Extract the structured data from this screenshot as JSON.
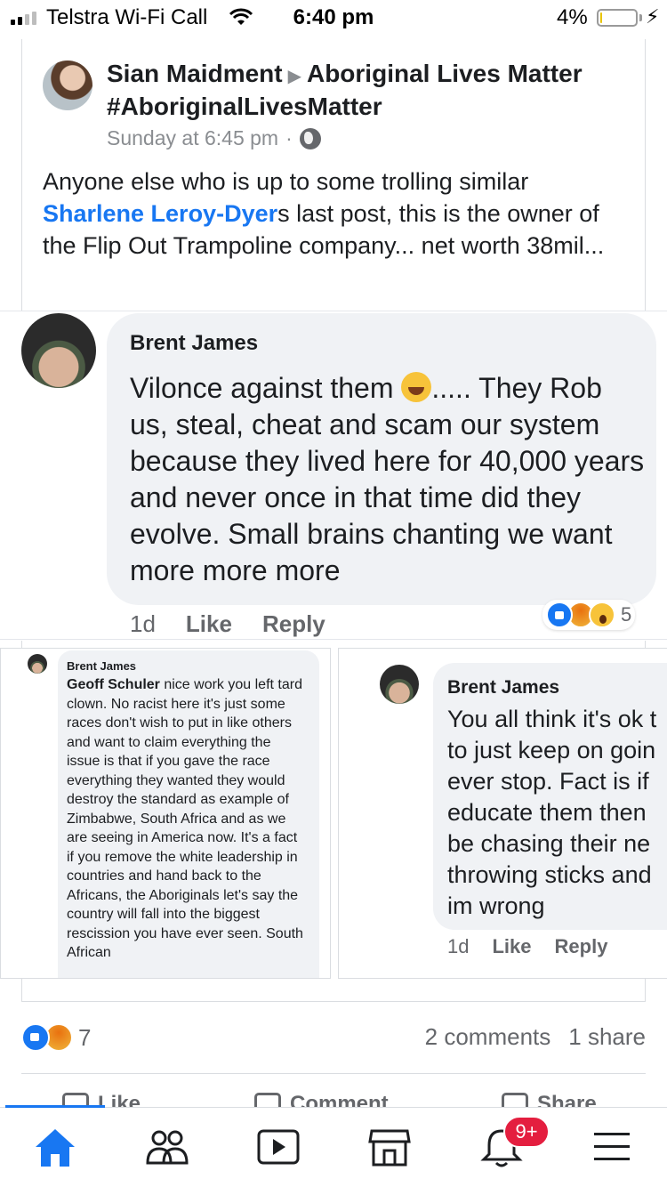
{
  "status_bar": {
    "carrier": "Telstra Wi-Fi Call",
    "time": "6:40 pm",
    "battery": "4%",
    "battery_level": 0.04,
    "charging_icon": "bolt-icon"
  },
  "post": {
    "author": "Sian Maidment",
    "group": "Aboriginal Lives Matter #AboriginalLivesMatter",
    "timestamp": "Sunday at 6:45 pm",
    "audience_icon": "globe-icon",
    "text_before": "Anyone else who is up to some trolling similar ",
    "mention": "Sharlene Leroy-Dyer",
    "text_after": "s last post, this is the owner of the Flip Out Trampoline company... net worth 38mil..."
  },
  "comment_main": {
    "author": "Brent James",
    "text_before_emoji": "Vilonce against them ",
    "emoji": "laughing-emoji",
    "text_after_emoji": "..... They Rob us, steal, cheat and scam our system because they lived here for 40,000 years and never once in that time did they evolve. Small brains chanting we want more more more",
    "time": "1d",
    "like_label": "Like",
    "reply_label": "Reply",
    "reaction_count": "5"
  },
  "shot_left": {
    "author": "Brent James",
    "mention": "Geoff Schuler",
    "text": " nice work you left tard clown. No racist here it's just some races don't wish to put in like others and want to claim everything the issue is that if you gave the race everything they wanted they would destroy the standard as example of Zimbabwe, South Africa and as we are seeing in America now. It's a fact if you remove the white leadership in countries and hand back to the Africans, the Aboriginals let's say the country will fall into the biggest rescission you have ever seen. South African"
  },
  "shot_right": {
    "author": "Brent James",
    "text": "You all think it's ok t\nto just keep on goin\never stop. Fact is if\neducate them then\nbe chasing their ne\nthrowing sticks and\nim wrong",
    "time": "1d",
    "like_label": "Like",
    "reply_label": "Reply"
  },
  "post_stats": {
    "reaction_count": "7",
    "comments": "2 comments",
    "shares": "1 share"
  },
  "post_actions": {
    "like": "Like",
    "comment": "Comment",
    "share": "Share"
  },
  "tab_bar": {
    "notification_badge": "9+",
    "active_color": "#1877f2",
    "icons": [
      "home-icon",
      "friends-icon",
      "watch-icon",
      "marketplace-icon",
      "notifications-icon",
      "menu-icon"
    ]
  }
}
